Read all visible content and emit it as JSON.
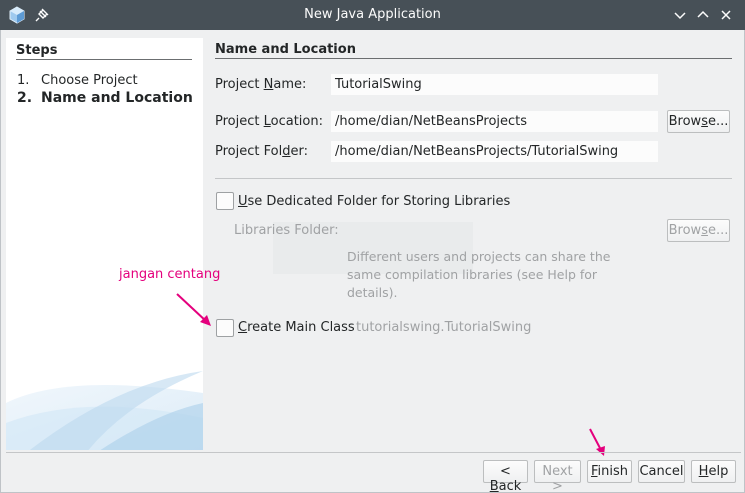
{
  "window": {
    "title": "New Java Application"
  },
  "steps": {
    "heading": "Steps",
    "items": [
      {
        "num": "1.",
        "label": "Choose Project"
      },
      {
        "num": "2.",
        "label": "Name and Location"
      }
    ]
  },
  "panel": {
    "heading": "Name and Location",
    "project_name": {
      "label_pre": "Project ",
      "label_mn": "N",
      "label_post": "ame:",
      "value": "TutorialSwing"
    },
    "project_location": {
      "label_pre": "Project ",
      "label_mn": "L",
      "label_post": "ocation:",
      "value": "/home/dian/NetBeansProjects"
    },
    "project_folder": {
      "label_pre": "Project Fol",
      "label_mn": "d",
      "label_post": "er:",
      "value": "/home/dian/NetBeansProjects/TutorialSwing"
    },
    "browse_label_pre": "Brow",
    "browse_label_mn": "s",
    "browse_label_post": "e...",
    "dedicated_folder": {
      "mn": "U",
      "rest": "se Dedicated Folder for Storing Libraries",
      "checked": false
    },
    "libraries_folder": {
      "label": "Libraries Folder:",
      "value": ""
    },
    "browse2_label_pre": "Brow",
    "browse2_label_mn": "s",
    "browse2_label_post": "e...",
    "hint": "Different users and projects can share the same compilation libraries (see Help for details).",
    "create_main": {
      "mn": "C",
      "rest": "reate Main Class",
      "checked": false,
      "value": "tutorialswing.TutorialSwing"
    }
  },
  "annotation": {
    "text": "jangan centang",
    "color": "#e4007d"
  },
  "buttons": {
    "back_pre": "< ",
    "back_mn": "B",
    "back_post": "ack",
    "next": "Next >",
    "finish_mn": "F",
    "finish_post": "inish",
    "cancel": "Cancel",
    "help_mn": "H",
    "help_post": "elp"
  }
}
